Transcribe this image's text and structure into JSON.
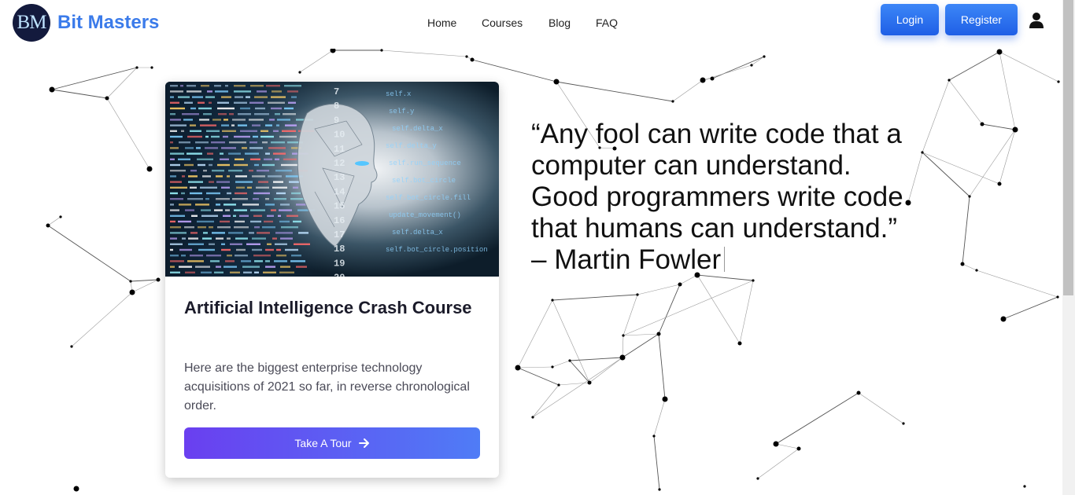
{
  "brand": {
    "logo_initials": "BM",
    "name": "Bit Masters"
  },
  "nav": {
    "items": [
      "Home",
      "Courses",
      "Blog",
      "FAQ"
    ]
  },
  "auth": {
    "login_label": "Login",
    "register_label": "Register",
    "profile_icon": "user-icon"
  },
  "card": {
    "image_icon": "ai-head-code-image",
    "title": "Artificial Intelligence Crash Course",
    "description": "Here are the biggest enterprise technology acquisitions of 2021 so far, in reverse chronological order.",
    "button_label": "Take A Tour",
    "button_icon": "arrow-right-icon"
  },
  "quote": {
    "lines": [
      "“Any fool can write code that a",
      "computer can understand.",
      "Good programmers write code",
      "that humans can understand.”"
    ],
    "author": "– Martin Fowler"
  },
  "colors": {
    "brand_blue": "#3b7bea",
    "logo_bg": "#131a3d",
    "button_start": "#6a3ff0",
    "button_end": "#4f7cf6"
  }
}
